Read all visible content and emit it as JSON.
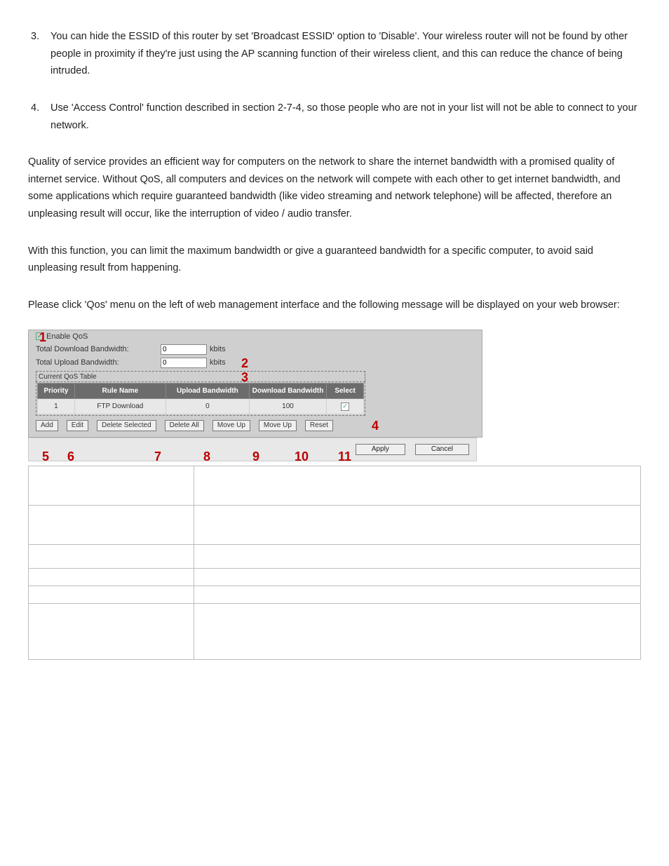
{
  "list": {
    "item3_num": "3.",
    "item3_txt": "You can hide the ESSID of this router by set 'Broadcast ESSID' option to 'Disable'. Your wireless router will not be found by other people in proximity if they're just using the AP scanning function of their wireless client, and this can reduce the chance of being intruded.",
    "item4_num": "4.",
    "item4_txt": "Use 'Access Control' function described in section 2-7-4, so those people who are not in your list will not be able to connect to your network."
  },
  "paragraphs": {
    "p1": "Quality of service provides an efficient way for computers on the network to share the internet bandwidth with a promised quality of internet service. Without QoS, all computers and devices on the network will compete with each other to get internet bandwidth, and some applications which require guaranteed bandwidth (like video streaming and network telephone) will be affected, therefore an unpleasing result will occur, like the interruption of video / audio transfer.",
    "p2": "With this function, you can limit the maximum bandwidth or give a guaranteed bandwidth for a specific computer, to avoid said unpleasing result from happening.",
    "p3": "Please click 'Qos' menu on the left of web management interface and the following message will be displayed on your web browser:"
  },
  "panel": {
    "enable_label": "Enable QoS",
    "dl_label": "Total Download Bandwidth:",
    "ul_label": "Total Upload Bandwidth:",
    "dl_value": "0",
    "ul_value": "0",
    "unit": "kbits",
    "section": "Current QoS Table",
    "cols": {
      "priority": "Priority",
      "rule": "Rule Name",
      "up": "Upload Bandwidth",
      "down": "Download Bandwidth",
      "sel": "Select"
    },
    "row": {
      "priority": "1",
      "rule": "FTP Download",
      "up": "0",
      "down": "100"
    },
    "buttons": {
      "add": "Add",
      "edit": "Edit",
      "delsel": "Delete Selected",
      "delall": "Delete All",
      "moveup1": "Move Up",
      "moveup2": "Move Up",
      "reset": "Reset",
      "apply": "Apply",
      "cancel": "Cancel"
    }
  },
  "callouts": {
    "c1": "1",
    "c2": "2",
    "c3": "3",
    "c4": "4",
    "c5": "5",
    "c6": "6",
    "c7": "7",
    "c8": "8",
    "c9": "9",
    "c10": "10",
    "c11": "11"
  }
}
